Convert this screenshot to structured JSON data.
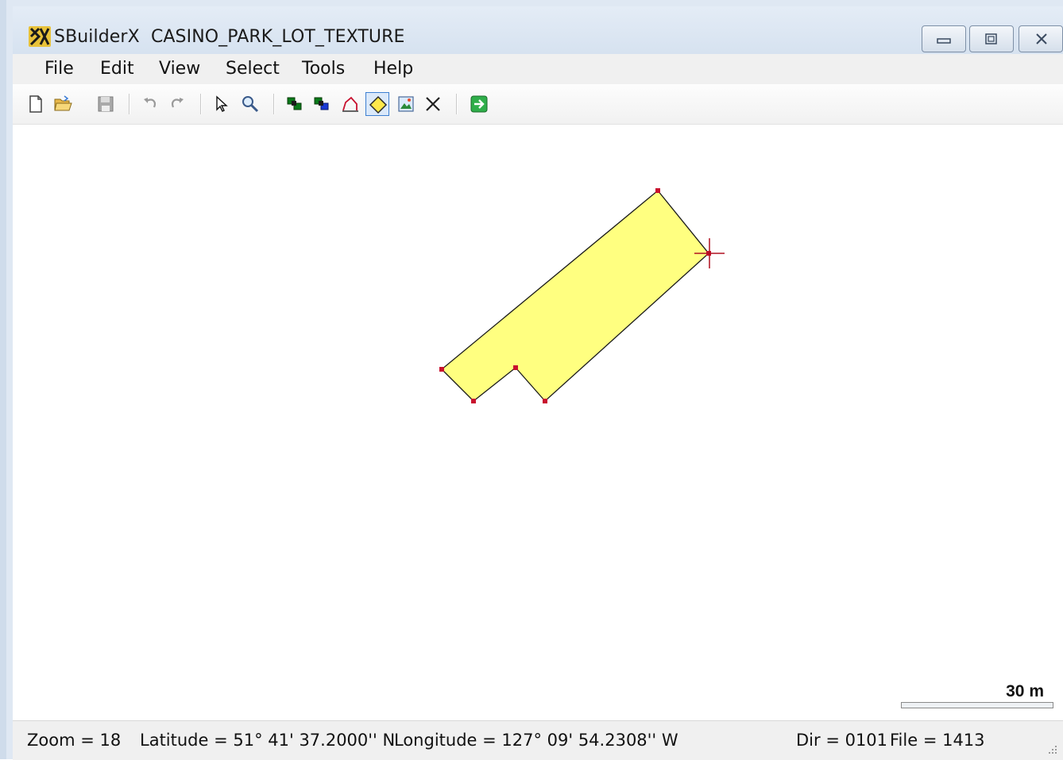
{
  "window": {
    "app_name": "SBuilderX",
    "document_title": "CASINO_PARK_LOT_TEXTURE"
  },
  "menu": [
    "File",
    "Edit",
    "View",
    "Select",
    "Tools",
    "Help"
  ],
  "toolbar": {
    "buttons": [
      {
        "name": "new-file-icon"
      },
      {
        "name": "open-folder-icon"
      },
      {
        "name": "save-icon"
      },
      {
        "name": "undo-icon"
      },
      {
        "name": "redo-icon"
      },
      {
        "name": "pointer-icon"
      },
      {
        "name": "zoom-icon"
      },
      {
        "name": "object-green-icon"
      },
      {
        "name": "object-blue-icon"
      },
      {
        "name": "line-tool-icon"
      },
      {
        "name": "polygon-tool-icon",
        "active": true
      },
      {
        "name": "bitmap-icon"
      },
      {
        "name": "delete-icon"
      },
      {
        "name": "compile-icon"
      }
    ]
  },
  "map": {
    "polygon_fill": "#ffff80",
    "polygon_stroke": "#1a1a1a",
    "vertex_color": "#c8102e",
    "scale_label": "30 m"
  },
  "status": {
    "zoom": "Zoom = 18",
    "latitude": "Latitude = 51° 41' 37.2000'' N",
    "longitude": "Longitude = 127° 09' 54.2308'' W",
    "dir": "Dir = 0101",
    "file": "File = 1413"
  }
}
